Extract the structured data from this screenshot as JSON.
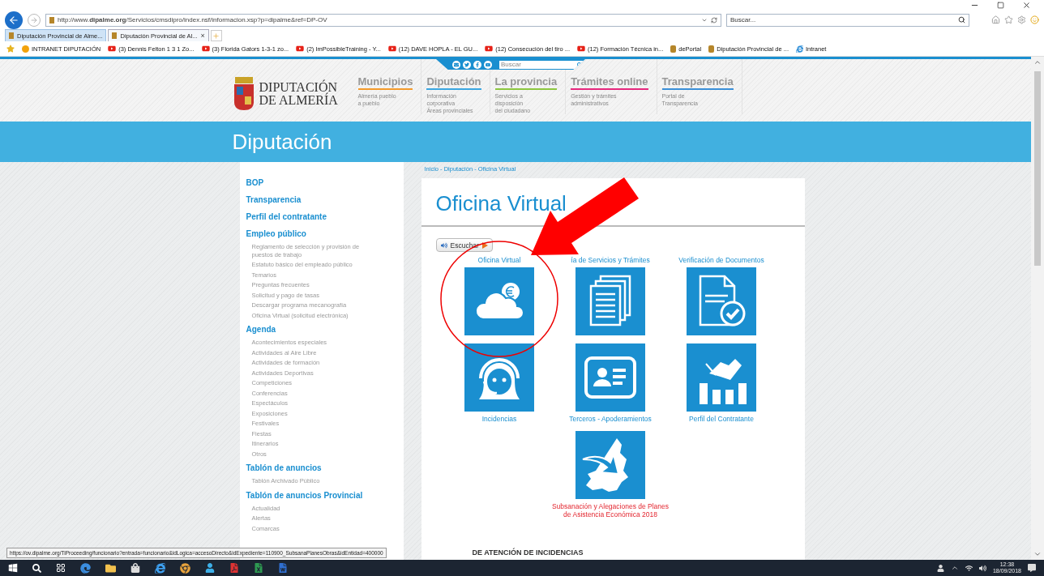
{
  "browser": {
    "address": "http://www.**dipalme.org**/Servicios/cmsdipro/index.nsf/informacion.xsp?p=dipalme&ref=DP-OV",
    "search_placeholder": "Buscar...",
    "tabs": [
      {
        "label": "Diputación Provincial de Alme...",
        "selected": false
      },
      {
        "label": "Diputación Provincial de Al...",
        "selected": true,
        "close": "×"
      }
    ],
    "favorites": [
      {
        "label": "INTRANET DIPUTACIÓN",
        "kind": "site"
      },
      {
        "label": "(3) Dennis Felton 1 3 1 Zo...",
        "kind": "youtube"
      },
      {
        "label": "(3) Florida Gators 1-3-1 zo...",
        "kind": "youtube"
      },
      {
        "label": "(2) ImPossibleTraining - Y...",
        "kind": "youtube"
      },
      {
        "label": "(12) DAVE HOPLA - EL GU...",
        "kind": "youtube"
      },
      {
        "label": "(12) Consecución del tiro ...",
        "kind": "youtube"
      },
      {
        "label": "(12) Formación Técnica in...",
        "kind": "youtube"
      },
      {
        "label": "dePortal",
        "kind": "shield"
      },
      {
        "label": "Diputación Provincial de ...",
        "kind": "shield"
      },
      {
        "label": "Intranet",
        "kind": "ie"
      }
    ]
  },
  "site_header": {
    "search_placeholder": "Buscar",
    "logo_lines": [
      "DIPUTACIÓN",
      "DE ALMERÍA"
    ],
    "nav": [
      {
        "title": "Municipios",
        "color": "#f39a2b",
        "subtitle_lines": [
          "Almería pueblo",
          "a pueblo"
        ]
      },
      {
        "title": "Diputación",
        "color": "#3aa6e0",
        "subtitle_lines": [
          "Información",
          "corporativa",
          "Áreas provinciales"
        ]
      },
      {
        "title": "La provincia",
        "color": "#8cc63f",
        "subtitle_lines": [
          "Servicios a",
          "disposición",
          "del ciudadano"
        ]
      },
      {
        "title": "Trámites online",
        "color": "#e6287d",
        "subtitle_lines": [
          "Gestión y trámites",
          "administrativos"
        ]
      },
      {
        "title": "Transparencia",
        "color": "#3a8fd8",
        "subtitle_lines": [
          "Portal de",
          "Transparencia"
        ]
      }
    ]
  },
  "section_title": "Diputación",
  "sidebar": [
    {
      "label": "BOP"
    },
    {
      "label": "Transparencia"
    },
    {
      "label": "Perfil del contratante"
    },
    {
      "label": "Empleo público",
      "children": [
        "Reglamento de selección y provisión de puestos de trabajo",
        "Estatuto básico del empleado público",
        "Temarios",
        "Preguntas frecuentes",
        "Solicitud y pago de tasas",
        "Descargar programa mecanografía",
        "Oficina Virtual (solicitud electrónica)"
      ]
    },
    {
      "label": "Agenda",
      "children": [
        "Acontecimientos especiales",
        "Actividades al Aire Libre",
        "Actividades de formación",
        "Actividades Deportivas",
        "Competiciones",
        "Conferencias",
        "Espectáculos",
        "Exposiciones",
        "Festivales",
        "Fiestas",
        "Itinerarios",
        "Otros"
      ]
    },
    {
      "label": "Tablón de anuncios",
      "children": [
        "Tablón Archivado Público"
      ]
    },
    {
      "label": "Tablón de anuncios Provincial",
      "children": [
        "Actualidad",
        "Alertas",
        "Comarcas"
      ]
    }
  ],
  "breadcrumb": "Inicio - Diputación - Oficina Virtual",
  "page_title": "Oficina Virtual",
  "listen_button": "Escuchar",
  "tile_rows": [
    {
      "kind": "labels_above",
      "tiles": [
        {
          "label": "Oficina Virtual",
          "highlighted": false
        },
        {
          "label": "ía de Servicios y Trámites",
          "highlighted": false
        },
        {
          "label": "Verificación de Documentos",
          "highlighted": false
        }
      ]
    },
    {
      "kind": "labels_below",
      "tiles": [
        {
          "label": "Incidencias",
          "highlighted": false
        },
        {
          "label": "Terceros - Apoderamientos",
          "highlighted": false
        },
        {
          "label": "Perfil del Contratante",
          "highlighted": false
        }
      ]
    },
    {
      "kind": "labels_below",
      "tiles": [
        {
          "label": "Subsanación y Alegaciones de Planes de Asistencia Económica 2018",
          "highlighted": true
        }
      ]
    }
  ],
  "footer_heading": "DE ATENCIÓN DE INCIDENCIAS",
  "status_url": "https://ov.dipalme.org/TiProceeding/funcionario?entrada=funcionario&idLogica=accesoDirecto&idExpediente=110900_SubsanaPlanesObras&idEntidad=400000",
  "taskbar": {
    "time": "12:38",
    "date": "18/09/2018"
  }
}
